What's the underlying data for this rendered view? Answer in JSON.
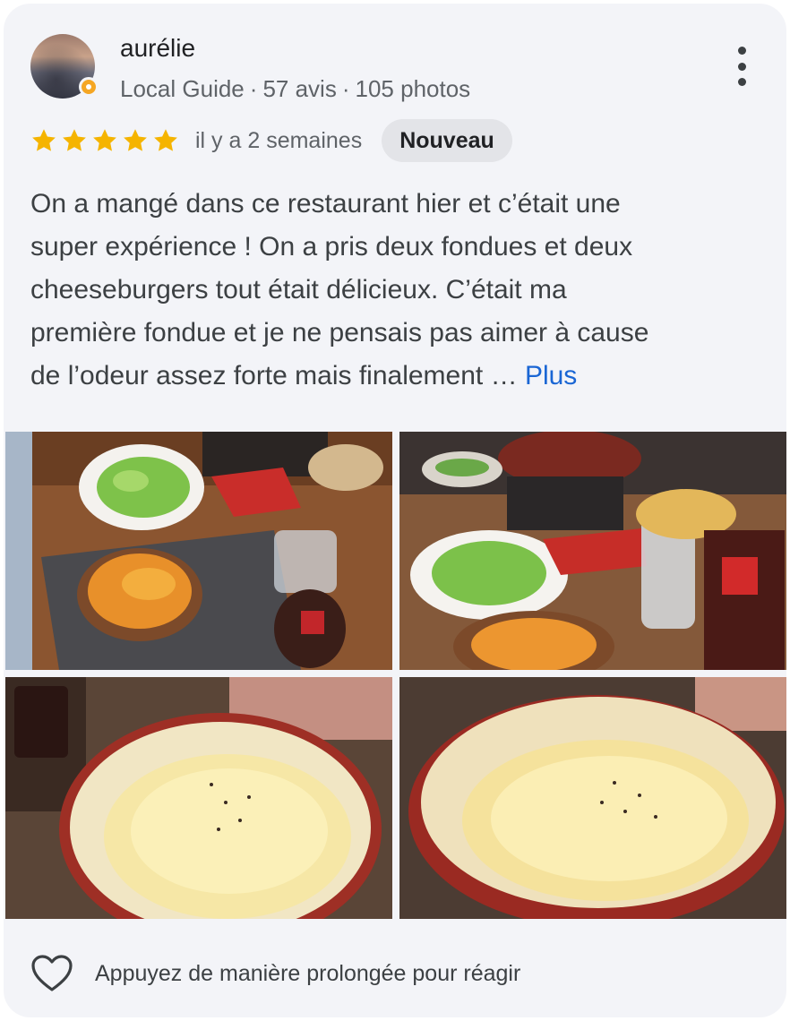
{
  "review": {
    "author": "aurélie",
    "guide_label": "Local Guide",
    "reviews_count": "57 avis",
    "photos_count": "105 photos",
    "meta_separator": "·",
    "rating": 5,
    "rating_max": 5,
    "date": "il y a 2 semaines",
    "badge": "Nouveau",
    "text_lines": [
      "On a mangé dans ce restaurant hier et c’était une",
      "super expérience ! On a pris deux fondues et deux",
      "cheeseburgers tout était délicieux. C’était ma",
      "première fondue et je ne pensais pas aimer à cause",
      "de l’odeur assez forte mais finalement …"
    ],
    "more_link": "Plus"
  },
  "icons": {
    "star": "star-icon",
    "more": "more-vert-icon",
    "heart": "heart-outline-icon",
    "badge": "local-guide-badge-icon"
  },
  "footer": {
    "react_hint": "Appuyez de manière prolongée pour réagir"
  },
  "colors": {
    "card_background": "#f3f4f8",
    "star": "#f5b400",
    "link": "#1a66d4",
    "badge_background": "#e3e4e8",
    "secondary_text": "#5f6368"
  }
}
